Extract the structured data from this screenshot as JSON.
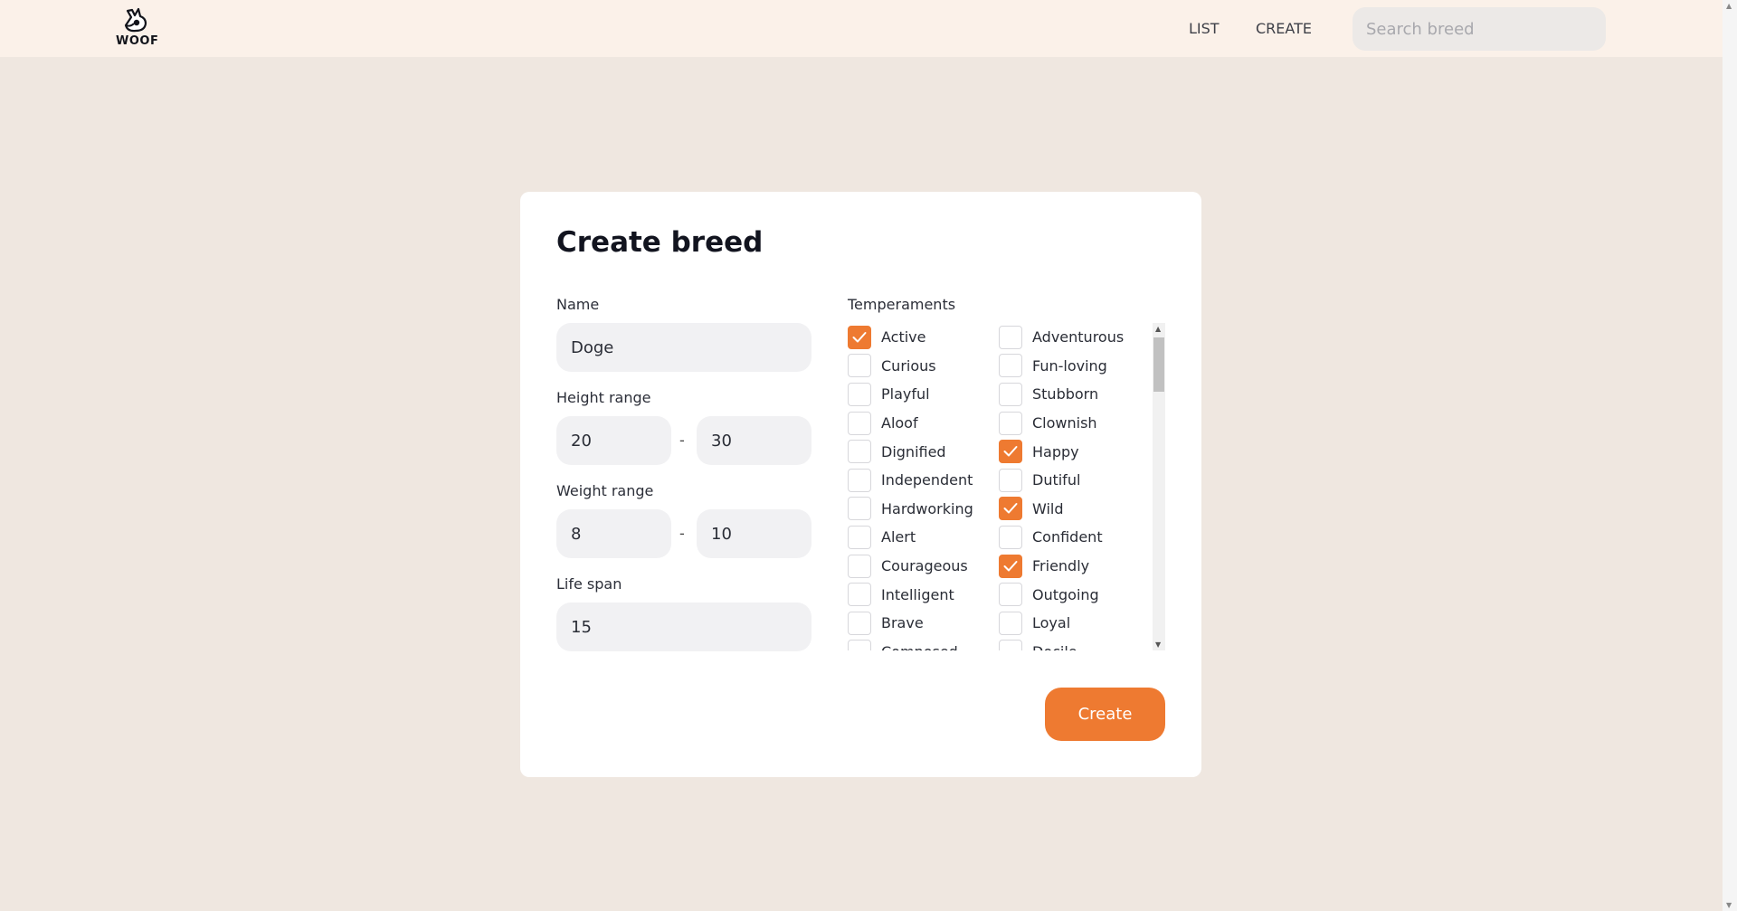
{
  "header": {
    "logo_text": "WOOF",
    "nav": {
      "list": "LIST",
      "create": "CREATE"
    },
    "search_placeholder": "Search breed"
  },
  "form": {
    "title": "Create breed",
    "name_label": "Name",
    "name_value": "Doge",
    "height_label": "Height range",
    "height_min": "20",
    "height_max": "30",
    "weight_label": "Weight range",
    "weight_min": "8",
    "weight_max": "10",
    "range_separator": "-",
    "lifespan_label": "Life span",
    "lifespan_value": "15",
    "temperaments_label": "Temperaments",
    "temperaments_left": [
      {
        "label": "Active",
        "checked": true
      },
      {
        "label": "Curious",
        "checked": false
      },
      {
        "label": "Playful",
        "checked": false
      },
      {
        "label": "Aloof",
        "checked": false
      },
      {
        "label": "Dignified",
        "checked": false
      },
      {
        "label": "Independent",
        "checked": false
      },
      {
        "label": "Hardworking",
        "checked": false
      },
      {
        "label": "Alert",
        "checked": false
      },
      {
        "label": "Courageous",
        "checked": false
      },
      {
        "label": "Intelligent",
        "checked": false
      },
      {
        "label": "Brave",
        "checked": false
      },
      {
        "label": "Composed",
        "checked": false
      }
    ],
    "temperaments_right": [
      {
        "label": "Adventurous",
        "checked": false
      },
      {
        "label": "Fun-loving",
        "checked": false
      },
      {
        "label": "Stubborn",
        "checked": false
      },
      {
        "label": "Clownish",
        "checked": false
      },
      {
        "label": "Happy",
        "checked": true
      },
      {
        "label": "Dutiful",
        "checked": false
      },
      {
        "label": "Wild",
        "checked": true
      },
      {
        "label": "Confident",
        "checked": false
      },
      {
        "label": "Friendly",
        "checked": true
      },
      {
        "label": "Outgoing",
        "checked": false
      },
      {
        "label": "Loyal",
        "checked": false
      },
      {
        "label": "Docile",
        "checked": false
      }
    ],
    "submit_label": "Create"
  },
  "colors": {
    "accent": "#ee7a31",
    "header_bg": "#fbf1e9",
    "page_bg": "#efe7e0"
  }
}
